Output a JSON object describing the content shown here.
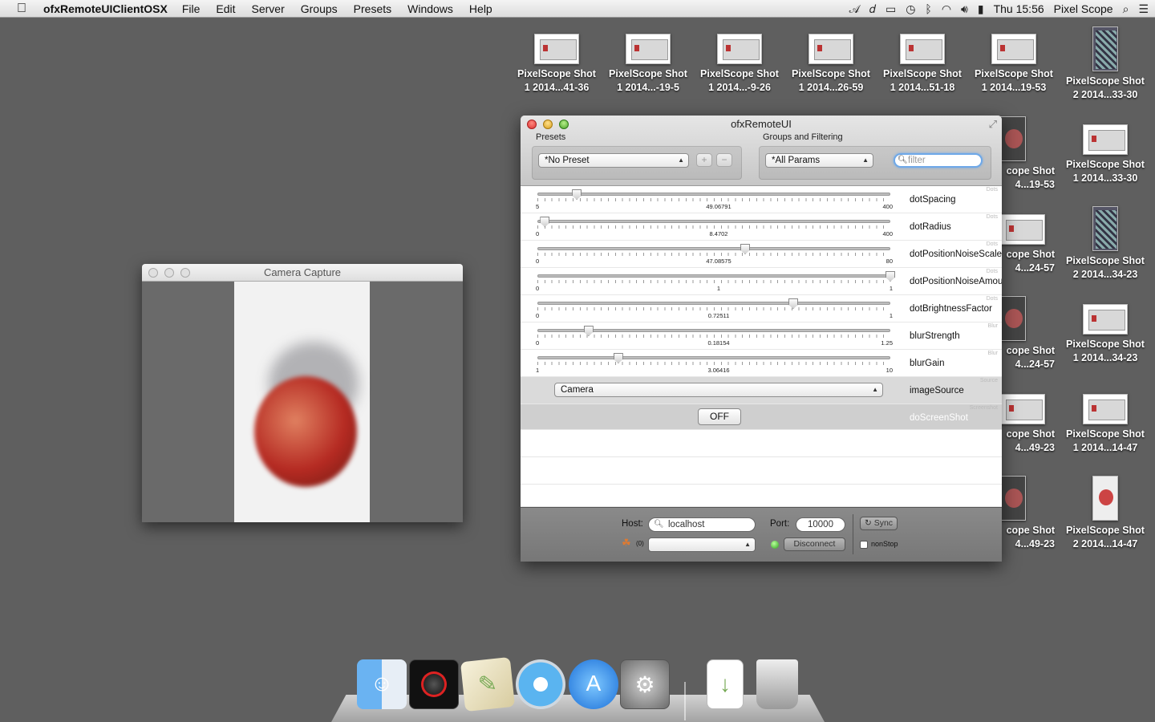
{
  "menubar": {
    "app_name": "ofxRemoteUIClientOSX",
    "items": [
      "File",
      "Edit",
      "Server",
      "Groups",
      "Presets",
      "Windows",
      "Help"
    ],
    "clock": "Thu 15:56",
    "user": "Pixel Scope"
  },
  "desktop_icons": [
    {
      "line1": "PixelScope Shot",
      "line2": "1 2014...41-36"
    },
    {
      "line1": "PixelScope Shot",
      "line2": "1 2014...-19-5"
    },
    {
      "line1": "PixelScope Shot",
      "line2": "1 2014...-9-26"
    },
    {
      "line1": "PixelScope Shot",
      "line2": "1 2014...26-59"
    },
    {
      "line1": "PixelScope Shot",
      "line2": "1 2014...51-18"
    },
    {
      "line1": "PixelScope Shot",
      "line2": "1 2014...19-53"
    },
    {
      "line1": "PixelScope Shot",
      "line2": "2 2014...33-30"
    },
    {
      "line1": "cope Shot",
      "line2": "4...19-53"
    },
    {
      "line1": "PixelScope Shot",
      "line2": "1 2014...33-30"
    },
    {
      "line1": "cope Shot",
      "line2": "4...24-57"
    },
    {
      "line1": "PixelScope Shot",
      "line2": "2 2014...34-23"
    },
    {
      "line1": "cope Shot",
      "line2": "4...24-57"
    },
    {
      "line1": "PixelScope Shot",
      "line2": "1 2014...34-23"
    },
    {
      "line1": "cope Shot",
      "line2": "4...49-23"
    },
    {
      "line1": "PixelScope Shot",
      "line2": "1 2014...14-47"
    },
    {
      "line1": "cope Shot",
      "line2": "4...49-23"
    },
    {
      "line1": "PixelScope Shot",
      "line2": "2 2014...14-47"
    }
  ],
  "camera_window": {
    "title": "Camera Capture"
  },
  "remote_window": {
    "title": "ofxRemoteUI",
    "presets_label": "Presets",
    "preset_selected": "*No Preset",
    "add_preset": "+",
    "remove_preset": "−",
    "groups_label": "Groups and Filtering",
    "group_selected": "*All Params",
    "filter_placeholder": "filter",
    "params": [
      {
        "name": "dotSpacing",
        "group": "Dots",
        "min": "5",
        "max": "400",
        "value": "49.06791",
        "fraction": 0.1116
      },
      {
        "name": "dotRadius",
        "group": "Dots",
        "min": "0",
        "max": "400",
        "value": "8.4702",
        "fraction": 0.0212
      },
      {
        "name": "dotPositionNoiseScale",
        "group": "Dots",
        "min": "0",
        "max": "80",
        "value": "47.08575",
        "fraction": 0.5886
      },
      {
        "name": "dotPositionNoiseAmount",
        "group": "Dots",
        "min": "0",
        "max": "1",
        "value": "1",
        "fraction": 1.0
      },
      {
        "name": "dotBrightnessFactor",
        "group": "Dots",
        "min": "0",
        "max": "1",
        "value": "0.72511",
        "fraction": 0.7251
      },
      {
        "name": "blurStrength",
        "group": "Blur",
        "min": "0",
        "max": "1.25",
        "value": "0.18154",
        "fraction": 0.1452
      },
      {
        "name": "blurGain",
        "group": "Blur",
        "min": "1",
        "max": "10",
        "value": "3.06416",
        "fraction": 0.2293
      }
    ],
    "image_source": {
      "name": "imageSource",
      "group": "Source",
      "value": "Camera"
    },
    "screenshot": {
      "name": "doScreenShot",
      "group": "Screenshot",
      "value": "OFF"
    },
    "host_label": "Host:",
    "host_value": "localhost",
    "port_label": "Port:",
    "port_value": "10000",
    "sync_label": "Sync",
    "neighbors_count": "(0)",
    "disconnect_label": "Disconnect",
    "nonstop_label": "nonStop",
    "colors": {
      "connected_led": "#2ba01c",
      "focus_ring": "#6ea8e8"
    }
  },
  "dock": [
    "finder-icon",
    "photo-booth-icon",
    "script-editor-icon",
    "safari-icon",
    "app-store-icon",
    "system-preferences-icon",
    "document-icon",
    "trash-icon"
  ]
}
